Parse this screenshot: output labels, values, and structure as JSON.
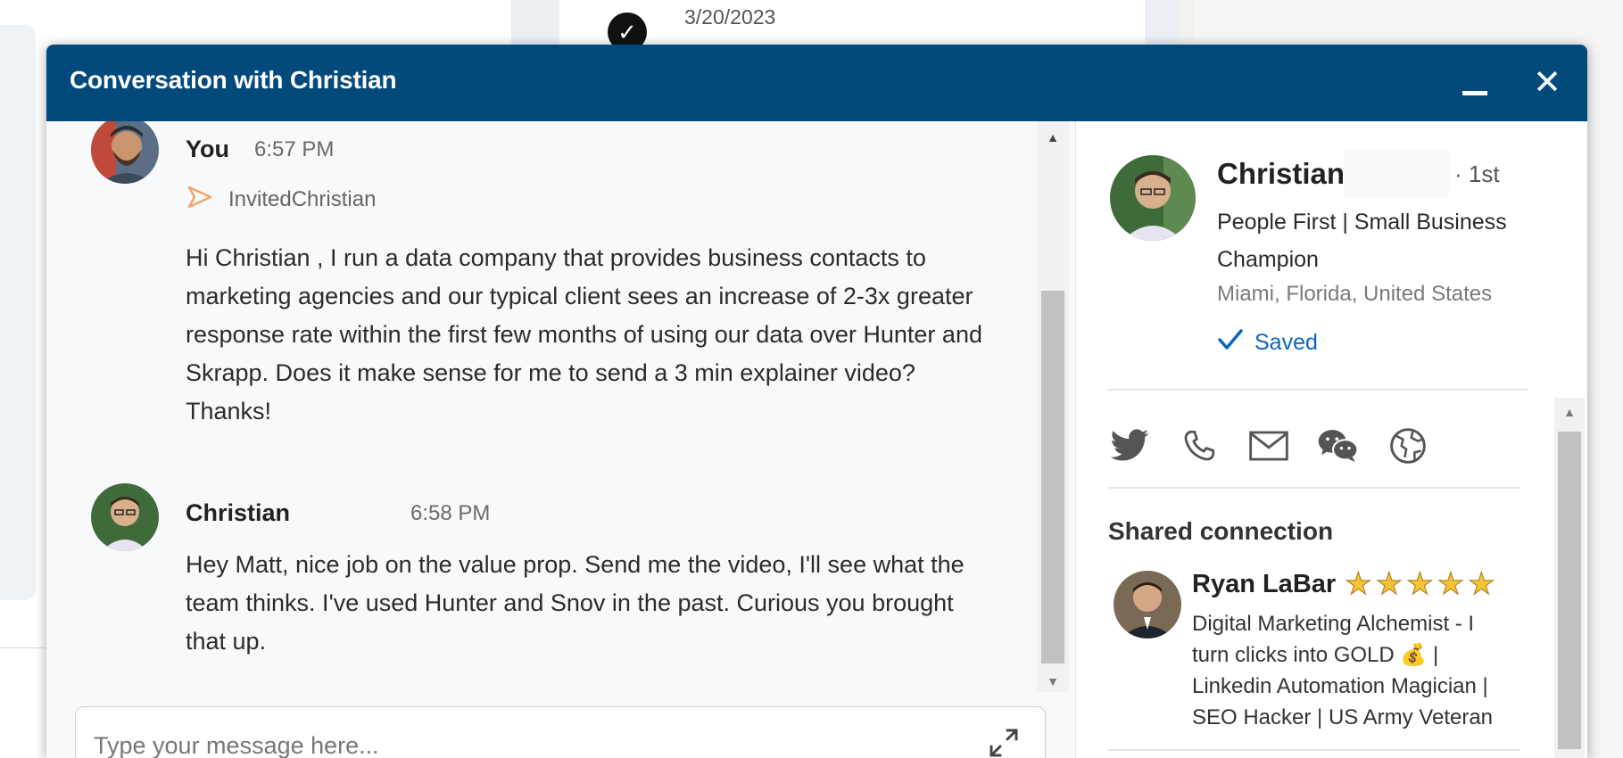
{
  "background": {
    "timeline_date": "3/20/2023"
  },
  "modal": {
    "title": "Conversation with Christian"
  },
  "conversation": {
    "messages": [
      {
        "sender": "You",
        "time": "6:57 PM",
        "invite_text": "InvitedChristian",
        "body": "Hi Christian , I run a data company that provides business contacts to marketing agencies and our typical client sees an increase of 2-3x greater response rate within the first few months of using our data over Hunter and Skrapp.  Does it make sense for me to send a 3 min explainer video? Thanks!"
      },
      {
        "sender": "Christian",
        "time": "6:58 PM",
        "body": "Hey Matt, nice job on the value prop. Send me the video, I'll see what the team thinks. I've used Hunter and Snov in the past. Curious you brought that up."
      }
    ],
    "composer_placeholder": "Type your message here..."
  },
  "profile": {
    "name": "Christian",
    "degree": "· 1st",
    "headline": "People First | Small Business Champion",
    "location": "Miami, Florida, United States",
    "saved_label": "Saved",
    "contact_icons": [
      "twitter-icon",
      "phone-icon",
      "email-icon",
      "wechat-icon",
      "website-icon"
    ],
    "shared_connection_title": "Shared connection",
    "shared_connection": {
      "name": "Ryan LaBar",
      "stars": 5,
      "headline": "Digital Marketing Alchemist - I turn clicks into GOLD 💰 | Linkedin Automation Magician | SEO Hacker | US Army Veteran"
    }
  },
  "colors": {
    "header_bg": "#034a7c",
    "accent": "#0a66c2",
    "invite_arrow": "#f5a469",
    "star": "#f7c233"
  }
}
